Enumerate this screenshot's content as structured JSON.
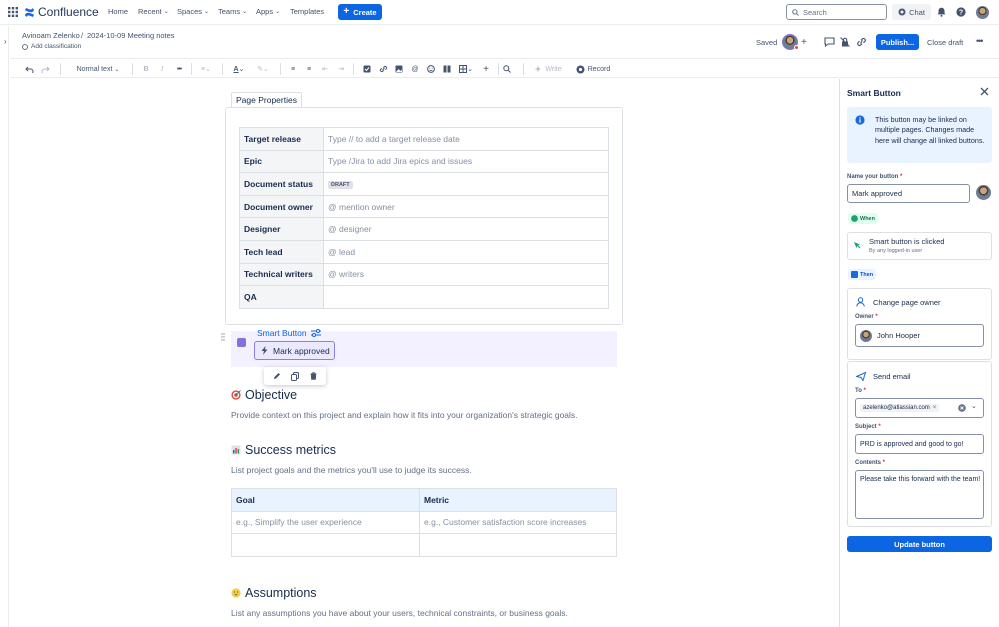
{
  "nav": {
    "logo_text": "Confluence",
    "items": [
      "Home",
      "Recent",
      "Spaces",
      "Teams",
      "Apps",
      "Templates"
    ],
    "create_label": "Create",
    "search_placeholder": "Search",
    "chat_label": "Chat"
  },
  "breadcrumb": {
    "space": "Avinoam Zelenko",
    "separator": "/",
    "page": "2024-10-09 Meeting notes",
    "classification": "Add classification"
  },
  "page_actions": {
    "status": "Saved",
    "publish_label": "Publish...",
    "close_draft_label": "Close draft"
  },
  "toolbar": {
    "text_style": "Normal text",
    "write_label": "Write",
    "record_label": "Record"
  },
  "page_properties": {
    "label": "Page Properties",
    "rows": [
      {
        "key": "Target release",
        "value": "Type // to add a target release date"
      },
      {
        "key": "Epic",
        "value": "Type /Jira to add Jira epics and issues"
      },
      {
        "key": "Document status",
        "value": "DRAFT"
      },
      {
        "key": "Document owner",
        "value": "@ mention owner"
      },
      {
        "key": "Designer",
        "value": "@ designer"
      },
      {
        "key": "Tech lead",
        "value": "@ lead"
      },
      {
        "key": "Technical writers",
        "value": "@ writers"
      },
      {
        "key": "QA",
        "value": ""
      }
    ]
  },
  "smart_button": {
    "title": "Smart Button",
    "button_label": "Mark approved"
  },
  "sections": {
    "objective": {
      "heading": "Objective",
      "text": "Provide context on this project and explain how it fits into your organization's strategic goals."
    },
    "success": {
      "heading": "Success metrics",
      "text": "List project goals and the metrics you'll use to judge its success."
    },
    "assumptions": {
      "heading": "Assumptions",
      "text": "List any assumptions you have about your users, technical constraints, or business goals."
    }
  },
  "goal_table": {
    "headers": [
      "Goal",
      "Metric"
    ],
    "rows": [
      [
        "e.g., Simplify the user experience",
        "e.g., Customer satisfaction score increases"
      ],
      [
        "",
        ""
      ]
    ]
  },
  "panel": {
    "title": "Smart Button",
    "info": "This button may be linked on multiple pages. Changes made here will change all linked buttons.",
    "name_label": "Name your button",
    "required_mark": "*",
    "name_value": "Mark approved",
    "when_label": "When",
    "trigger_title": "Smart button is clicked",
    "trigger_sub": "By any logged-in user",
    "then_label": "Then",
    "action1_title": "Change page owner",
    "owner_label": "Owner",
    "owner_value": "John Hooper",
    "action2_title": "Send email",
    "to_label": "To",
    "to_value": "azelenko@atlassian.com",
    "subject_label": "Subject",
    "subject_value": "PRD is approved and good to go!",
    "contents_label": "Contents",
    "contents_value": "Please take this forward with the team!",
    "update_label": "Update button"
  },
  "colors": {
    "brand_blue": "#0c66e4",
    "smart_purple": "#8270db",
    "when_green": "#22a06b"
  }
}
